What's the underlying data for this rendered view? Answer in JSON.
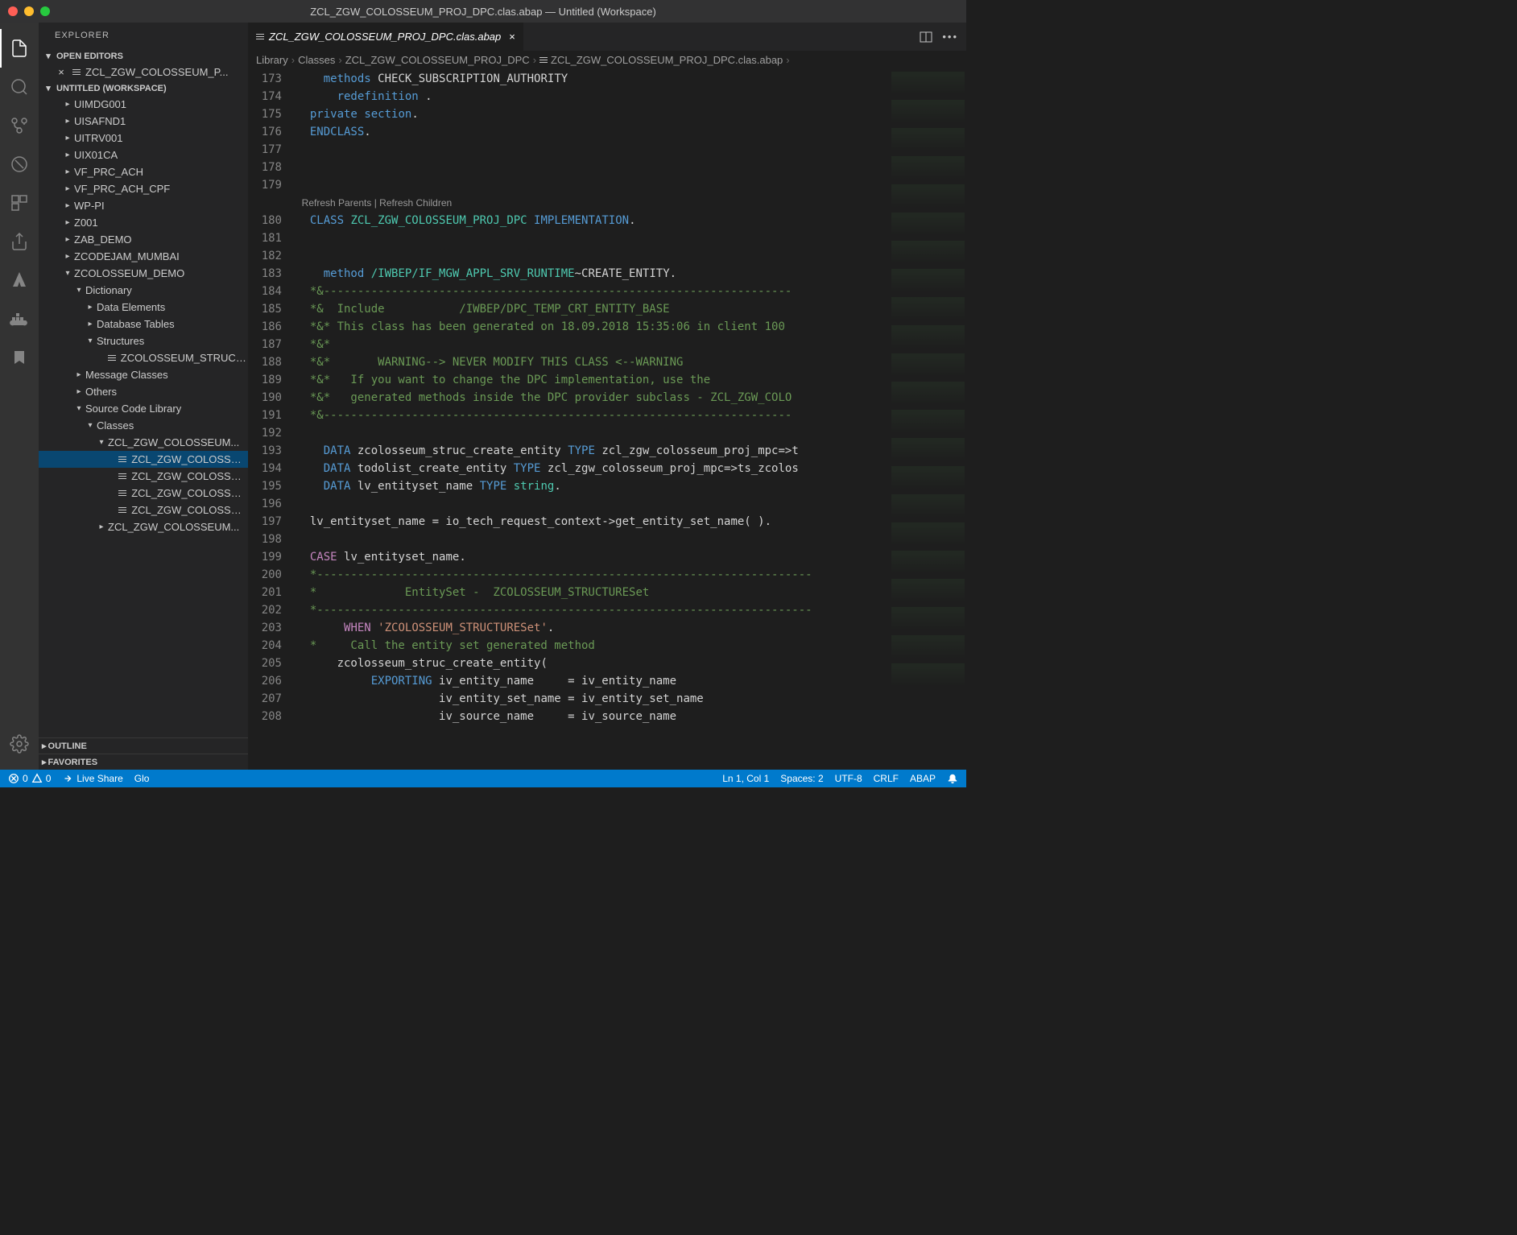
{
  "titlebar": {
    "title": "ZCL_ZGW_COLOSSEUM_PROJ_DPC.clas.abap — Untitled (Workspace)"
  },
  "sidebar": {
    "title": "EXPLORER",
    "open_editors_label": "OPEN EDITORS",
    "open_editor_file": "ZCL_ZGW_COLOSSEUM_P...",
    "workspace_label": "UNTITLED (WORKSPACE)",
    "tree": [
      {
        "label": "UIMDG001",
        "indent": 2,
        "chev": "▸"
      },
      {
        "label": "UISAFND1",
        "indent": 2,
        "chev": "▸"
      },
      {
        "label": "UITRV001",
        "indent": 2,
        "chev": "▸"
      },
      {
        "label": "UIX01CA",
        "indent": 2,
        "chev": "▸"
      },
      {
        "label": "VF_PRC_ACH",
        "indent": 2,
        "chev": "▸"
      },
      {
        "label": "VF_PRC_ACH_CPF",
        "indent": 2,
        "chev": "▸"
      },
      {
        "label": "WP-PI",
        "indent": 2,
        "chev": "▸"
      },
      {
        "label": "Z001",
        "indent": 2,
        "chev": "▸"
      },
      {
        "label": "ZAB_DEMO",
        "indent": 2,
        "chev": "▸"
      },
      {
        "label": "ZCODEJAM_MUMBAI",
        "indent": 2,
        "chev": "▸"
      },
      {
        "label": "ZCOLOSSEUM_DEMO",
        "indent": 2,
        "chev": "▾"
      },
      {
        "label": "Dictionary",
        "indent": 3,
        "chev": "▾"
      },
      {
        "label": "Data Elements",
        "indent": 4,
        "chev": "▸"
      },
      {
        "label": "Database Tables",
        "indent": 4,
        "chev": "▸"
      },
      {
        "label": "Structures",
        "indent": 4,
        "chev": "▾"
      },
      {
        "label": "ZCOLOSSEUM_STRUCT...",
        "indent": 5,
        "chev": "",
        "file": true
      },
      {
        "label": "Message Classes",
        "indent": 3,
        "chev": "▸"
      },
      {
        "label": "Others",
        "indent": 3,
        "chev": "▸"
      },
      {
        "label": "Source Code Library",
        "indent": 3,
        "chev": "▾"
      },
      {
        "label": "Classes",
        "indent": 4,
        "chev": "▾"
      },
      {
        "label": "ZCL_ZGW_COLOSSEUM...",
        "indent": 5,
        "chev": "▾"
      },
      {
        "label": "ZCL_ZGW_COLOSSEU...",
        "indent": 6,
        "chev": "",
        "file": true,
        "selected": true
      },
      {
        "label": "ZCL_ZGW_COLOSSEU...",
        "indent": 6,
        "chev": "",
        "file": true
      },
      {
        "label": "ZCL_ZGW_COLOSSEU...",
        "indent": 6,
        "chev": "",
        "file": true
      },
      {
        "label": "ZCL_ZGW_COLOSSEU...",
        "indent": 6,
        "chev": "",
        "file": true
      },
      {
        "label": "ZCL_ZGW_COLOSSEUM...",
        "indent": 5,
        "chev": "▸"
      }
    ],
    "outline_label": "OUTLINE",
    "favorites_label": "FAVORITES"
  },
  "tab": {
    "filename": "ZCL_ZGW_COLOSSEUM_PROJ_DPC.clas.abap"
  },
  "breadcrumb": {
    "p1": "Library",
    "p2": "Classes",
    "p3": "ZCL_ZGW_COLOSSEUM_PROJ_DPC",
    "p4": "ZCL_ZGW_COLOSSEUM_PROJ_DPC.clas.abap"
  },
  "code": {
    "line_start": 173,
    "codelens": "Refresh Parents | Refresh Children",
    "lines": [
      {
        "n": 173,
        "html": "    <span class='kw-blue'>methods</span> <span class='kw-white'>CHECK_SUBSCRIPTION_AUTHORITY</span>"
      },
      {
        "n": 174,
        "html": "      <span class='kw-blue'>redefinition</span> <span class='kw-white'>.</span>"
      },
      {
        "n": 175,
        "html": "  <span class='kw-blue'>private</span> <span class='kw-blue'>section</span><span class='kw-white'>.</span>"
      },
      {
        "n": 176,
        "html": "  <span class='kw-blue'>ENDCLASS</span><span class='kw-white'>.</span>"
      },
      {
        "n": 177,
        "html": ""
      },
      {
        "n": 178,
        "html": ""
      },
      {
        "n": 179,
        "html": ""
      },
      {
        "n": 0,
        "html": "<span class='codelens'>  Refresh Parents | Refresh Children</span>"
      },
      {
        "n": 180,
        "html": "  <span class='kw-blue'>CLASS</span> <span class='kw-teal'>ZCL_ZGW_COLOSSEUM_PROJ_DPC</span> <span class='kw-blue'>IMPLEMENTATION</span><span class='kw-white'>.</span>"
      },
      {
        "n": 181,
        "html": ""
      },
      {
        "n": 182,
        "html": ""
      },
      {
        "n": 183,
        "html": "    <span class='kw-blue'>method</span> <span class='kw-teal'>/IWBEP/IF_MGW_APPL_SRV_RUNTIME</span><span class='kw-white'>~</span><span class='kw-white'>CREATE_ENTITY</span><span class='kw-white'>.</span>"
      },
      {
        "n": 184,
        "html": "  <span class='kw-green'>*&---------------------------------------------------------------------</span>"
      },
      {
        "n": 185,
        "html": "  <span class='kw-green'>*&  Include           /IWBEP/DPC_TEMP_CRT_ENTITY_BASE</span>"
      },
      {
        "n": 186,
        "html": "  <span class='kw-green'>*&* This class has been generated on 18.09.2018 15:35:06 in client 100</span>"
      },
      {
        "n": 187,
        "html": "  <span class='kw-green'>*&*</span>"
      },
      {
        "n": 188,
        "html": "  <span class='kw-green'>*&*       WARNING--> NEVER MODIFY THIS CLASS <--WARNING</span>"
      },
      {
        "n": 189,
        "html": "  <span class='kw-green'>*&*   If you want to change the DPC implementation, use the</span>"
      },
      {
        "n": 190,
        "html": "  <span class='kw-green'>*&*   generated methods inside the DPC provider subclass - ZCL_ZGW_COLO</span>"
      },
      {
        "n": 191,
        "html": "  <span class='kw-green'>*&---------------------------------------------------------------------</span>"
      },
      {
        "n": 192,
        "html": ""
      },
      {
        "n": 193,
        "html": "    <span class='kw-blue'>DATA</span> <span class='kw-white'>zcolosseum_struc_create_entity</span> <span class='kw-blue'>TYPE</span> <span class='kw-white'>zcl_zgw_colosseum_proj_mpc=>t</span>"
      },
      {
        "n": 194,
        "html": "    <span class='kw-blue'>DATA</span> <span class='kw-white'>todolist_create_entity</span> <span class='kw-blue'>TYPE</span> <span class='kw-white'>zcl_zgw_colosseum_proj_mpc=>ts_zcolos</span>"
      },
      {
        "n": 195,
        "html": "    <span class='kw-blue'>DATA</span> <span class='kw-white'>lv_entityset_name</span> <span class='kw-blue'>TYPE</span> <span class='kw-teal'>string</span><span class='kw-white'>.</span>"
      },
      {
        "n": 196,
        "html": ""
      },
      {
        "n": 197,
        "html": "  <span class='kw-white'>lv_entityset_name = io_tech_request_context->get_entity_set_name( ).</span>"
      },
      {
        "n": 198,
        "html": ""
      },
      {
        "n": 199,
        "html": "  <span class='kw-purple'>CASE</span> <span class='kw-white'>lv_entityset_name</span><span class='kw-white'>.</span>"
      },
      {
        "n": 200,
        "html": "  <span class='kw-green'>*-------------------------------------------------------------------------</span>"
      },
      {
        "n": 201,
        "html": "  <span class='kw-green'>*             EntitySet -  ZCOLOSSEUM_STRUCTURESet</span>"
      },
      {
        "n": 202,
        "html": "  <span class='kw-green'>*-------------------------------------------------------------------------</span>"
      },
      {
        "n": 203,
        "html": "       <span class='kw-purple'>WHEN</span> <span class='kw-orange'>'ZCOLOSSEUM_STRUCTURESet'</span><span class='kw-white'>.</span>"
      },
      {
        "n": 204,
        "html": "  <span class='kw-green'>*     Call the entity set generated method</span>"
      },
      {
        "n": 205,
        "html": "      <span class='kw-white'>zcolosseum_struc_create_entity(</span>"
      },
      {
        "n": 206,
        "html": "           <span class='kw-blue'>EXPORTING</span> <span class='kw-white'>iv_entity_name     = iv_entity_name</span>"
      },
      {
        "n": 207,
        "html": "                     <span class='kw-white'>iv_entity_set_name = iv_entity_set_name</span>"
      },
      {
        "n": 208,
        "html": "                     <span class='kw-white'>iv_source_name     = iv_source_name</span>"
      }
    ]
  },
  "statusbar": {
    "errors": "0",
    "warnings": "0",
    "liveshare": "Live Share",
    "glo": "Glo",
    "position": "Ln 1, Col 1",
    "spaces": "Spaces: 2",
    "encoding": "UTF-8",
    "eol": "CRLF",
    "lang": "ABAP"
  }
}
